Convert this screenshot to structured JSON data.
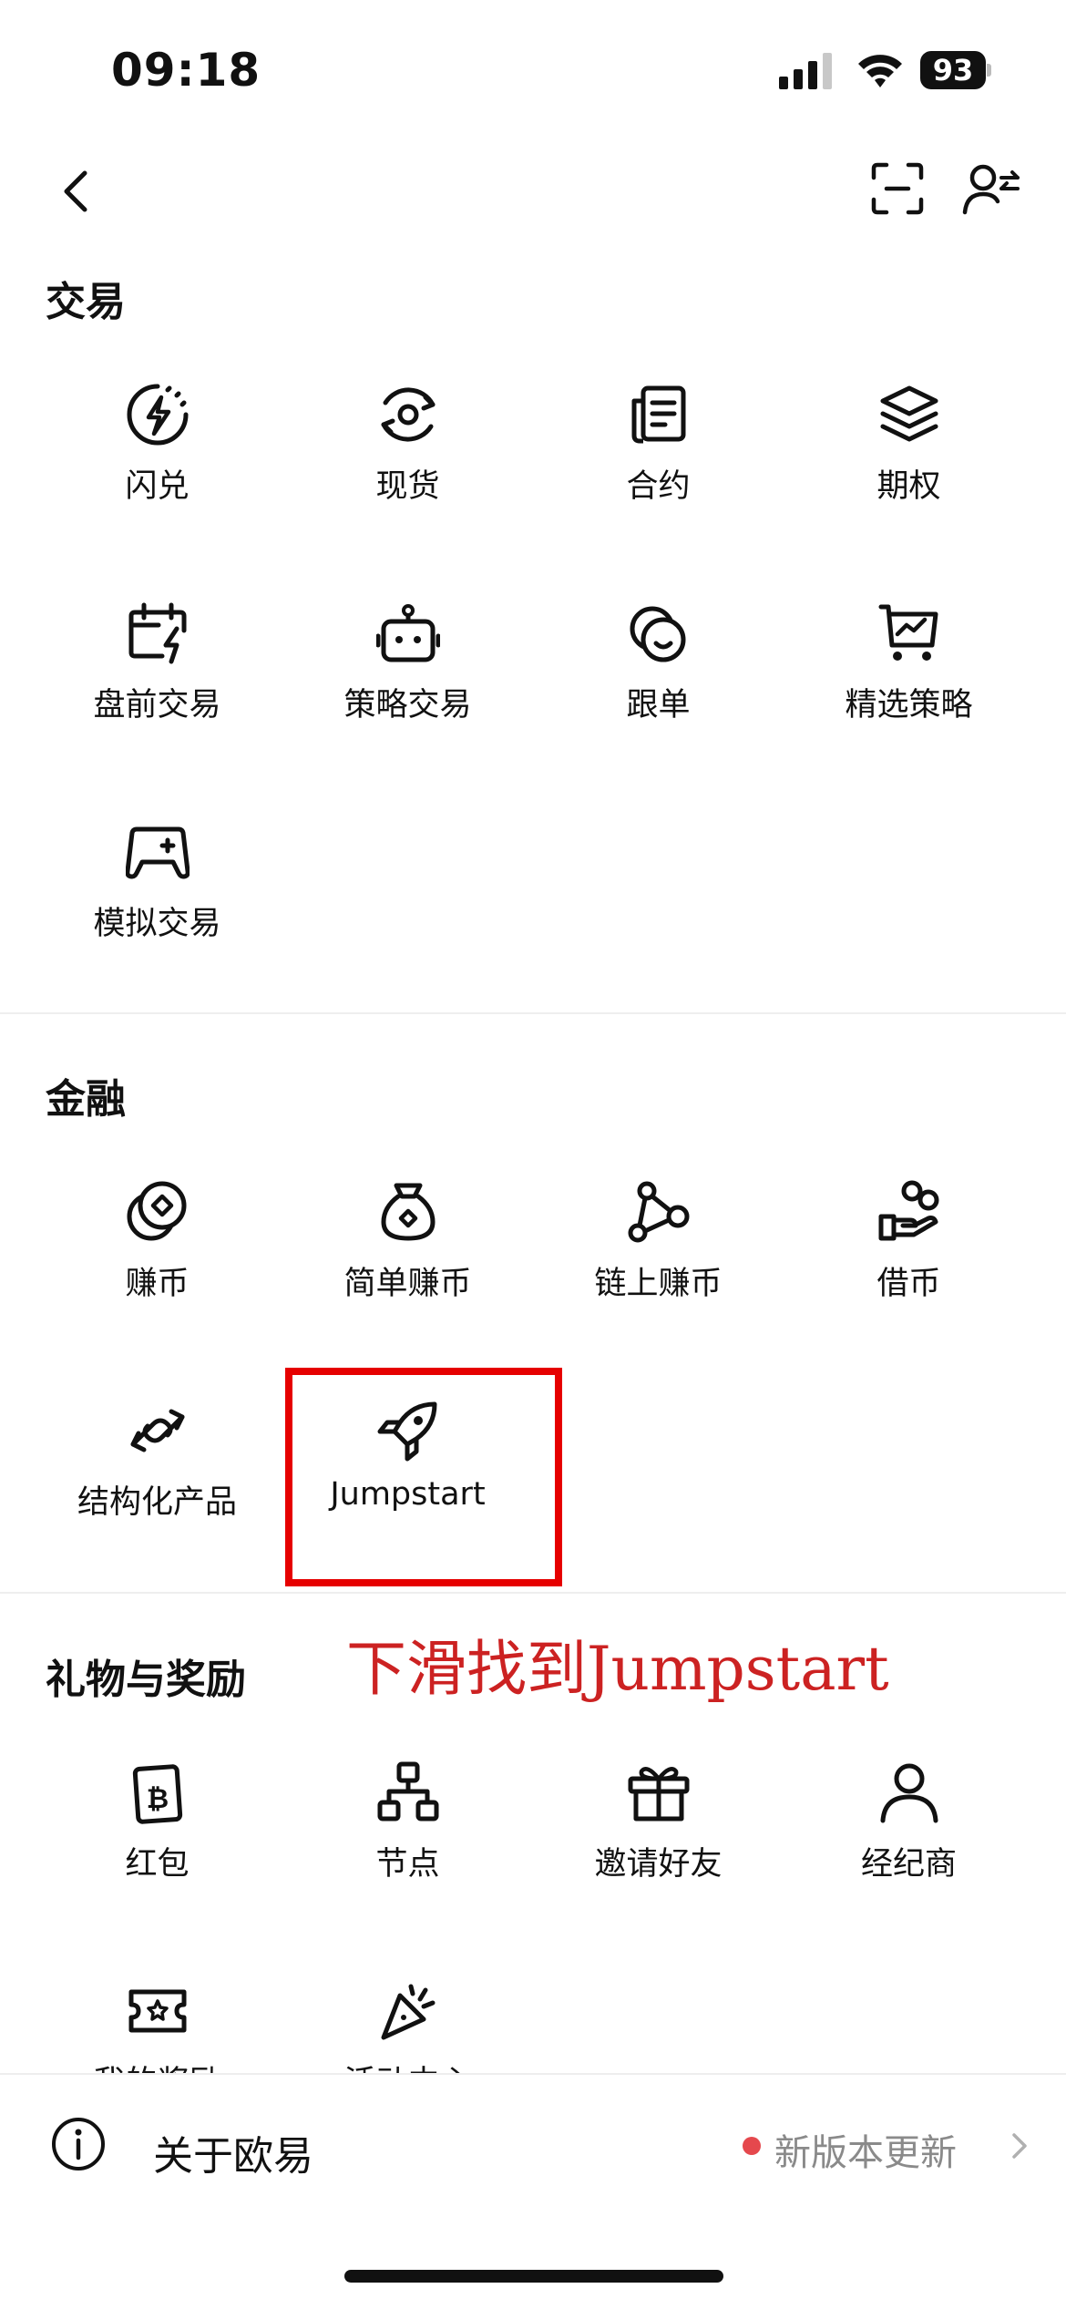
{
  "status_bar": {
    "time": "09:18",
    "battery": "93"
  },
  "sections": {
    "trade": {
      "title": "交易",
      "items": [
        "闪兑",
        "现货",
        "合约",
        "期权",
        "盘前交易",
        "策略交易",
        "跟单",
        "精选策略",
        "模拟交易"
      ]
    },
    "finance": {
      "title": "金融",
      "items": [
        "赚币",
        "简单赚币",
        "链上赚币",
        "借币",
        "结构化产品",
        "Jumpstart"
      ]
    },
    "rewards": {
      "title": "礼物与奖励",
      "items": [
        "红包",
        "节点",
        "邀请好友",
        "经纪商",
        "我的奖励",
        "活动中心"
      ]
    }
  },
  "annotation": "下滑找到Jumpstart",
  "bottom": {
    "about_label": "关于欧易",
    "update_label": "新版本更新"
  },
  "colors": {
    "highlight": "#e60000",
    "annotation": "#cc2222",
    "update_dot": "#e5484d"
  }
}
